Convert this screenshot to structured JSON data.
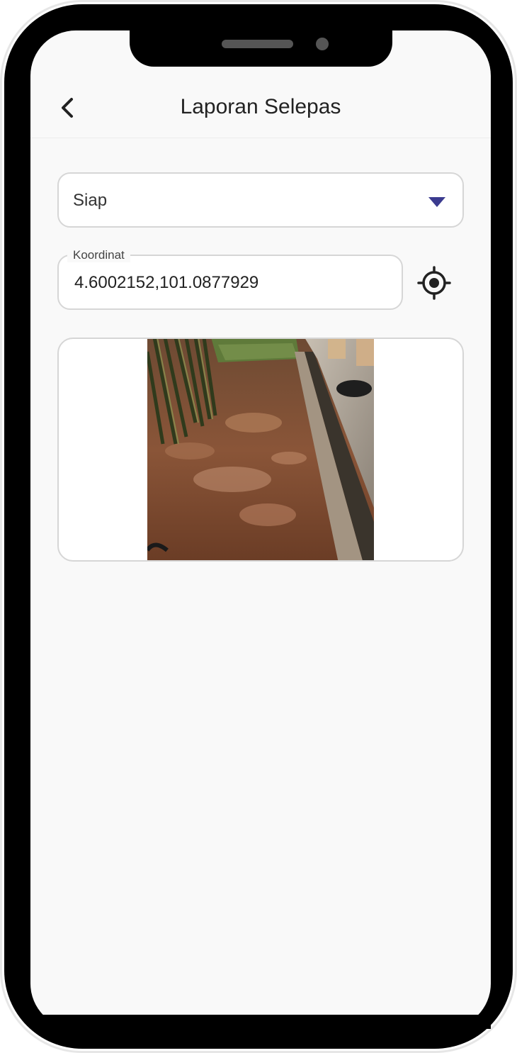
{
  "header": {
    "title": "Laporan Selepas",
    "back_icon": "chevron-left-icon"
  },
  "status_dropdown": {
    "selected": "Siap",
    "arrow_color": "#3b3b8f"
  },
  "coordinates": {
    "label": "Koordinat",
    "value": "4.6002152,101.0877929",
    "locate_icon": "gps-target-icon"
  },
  "photo": {
    "description_icon": "photo-thumbnail"
  }
}
